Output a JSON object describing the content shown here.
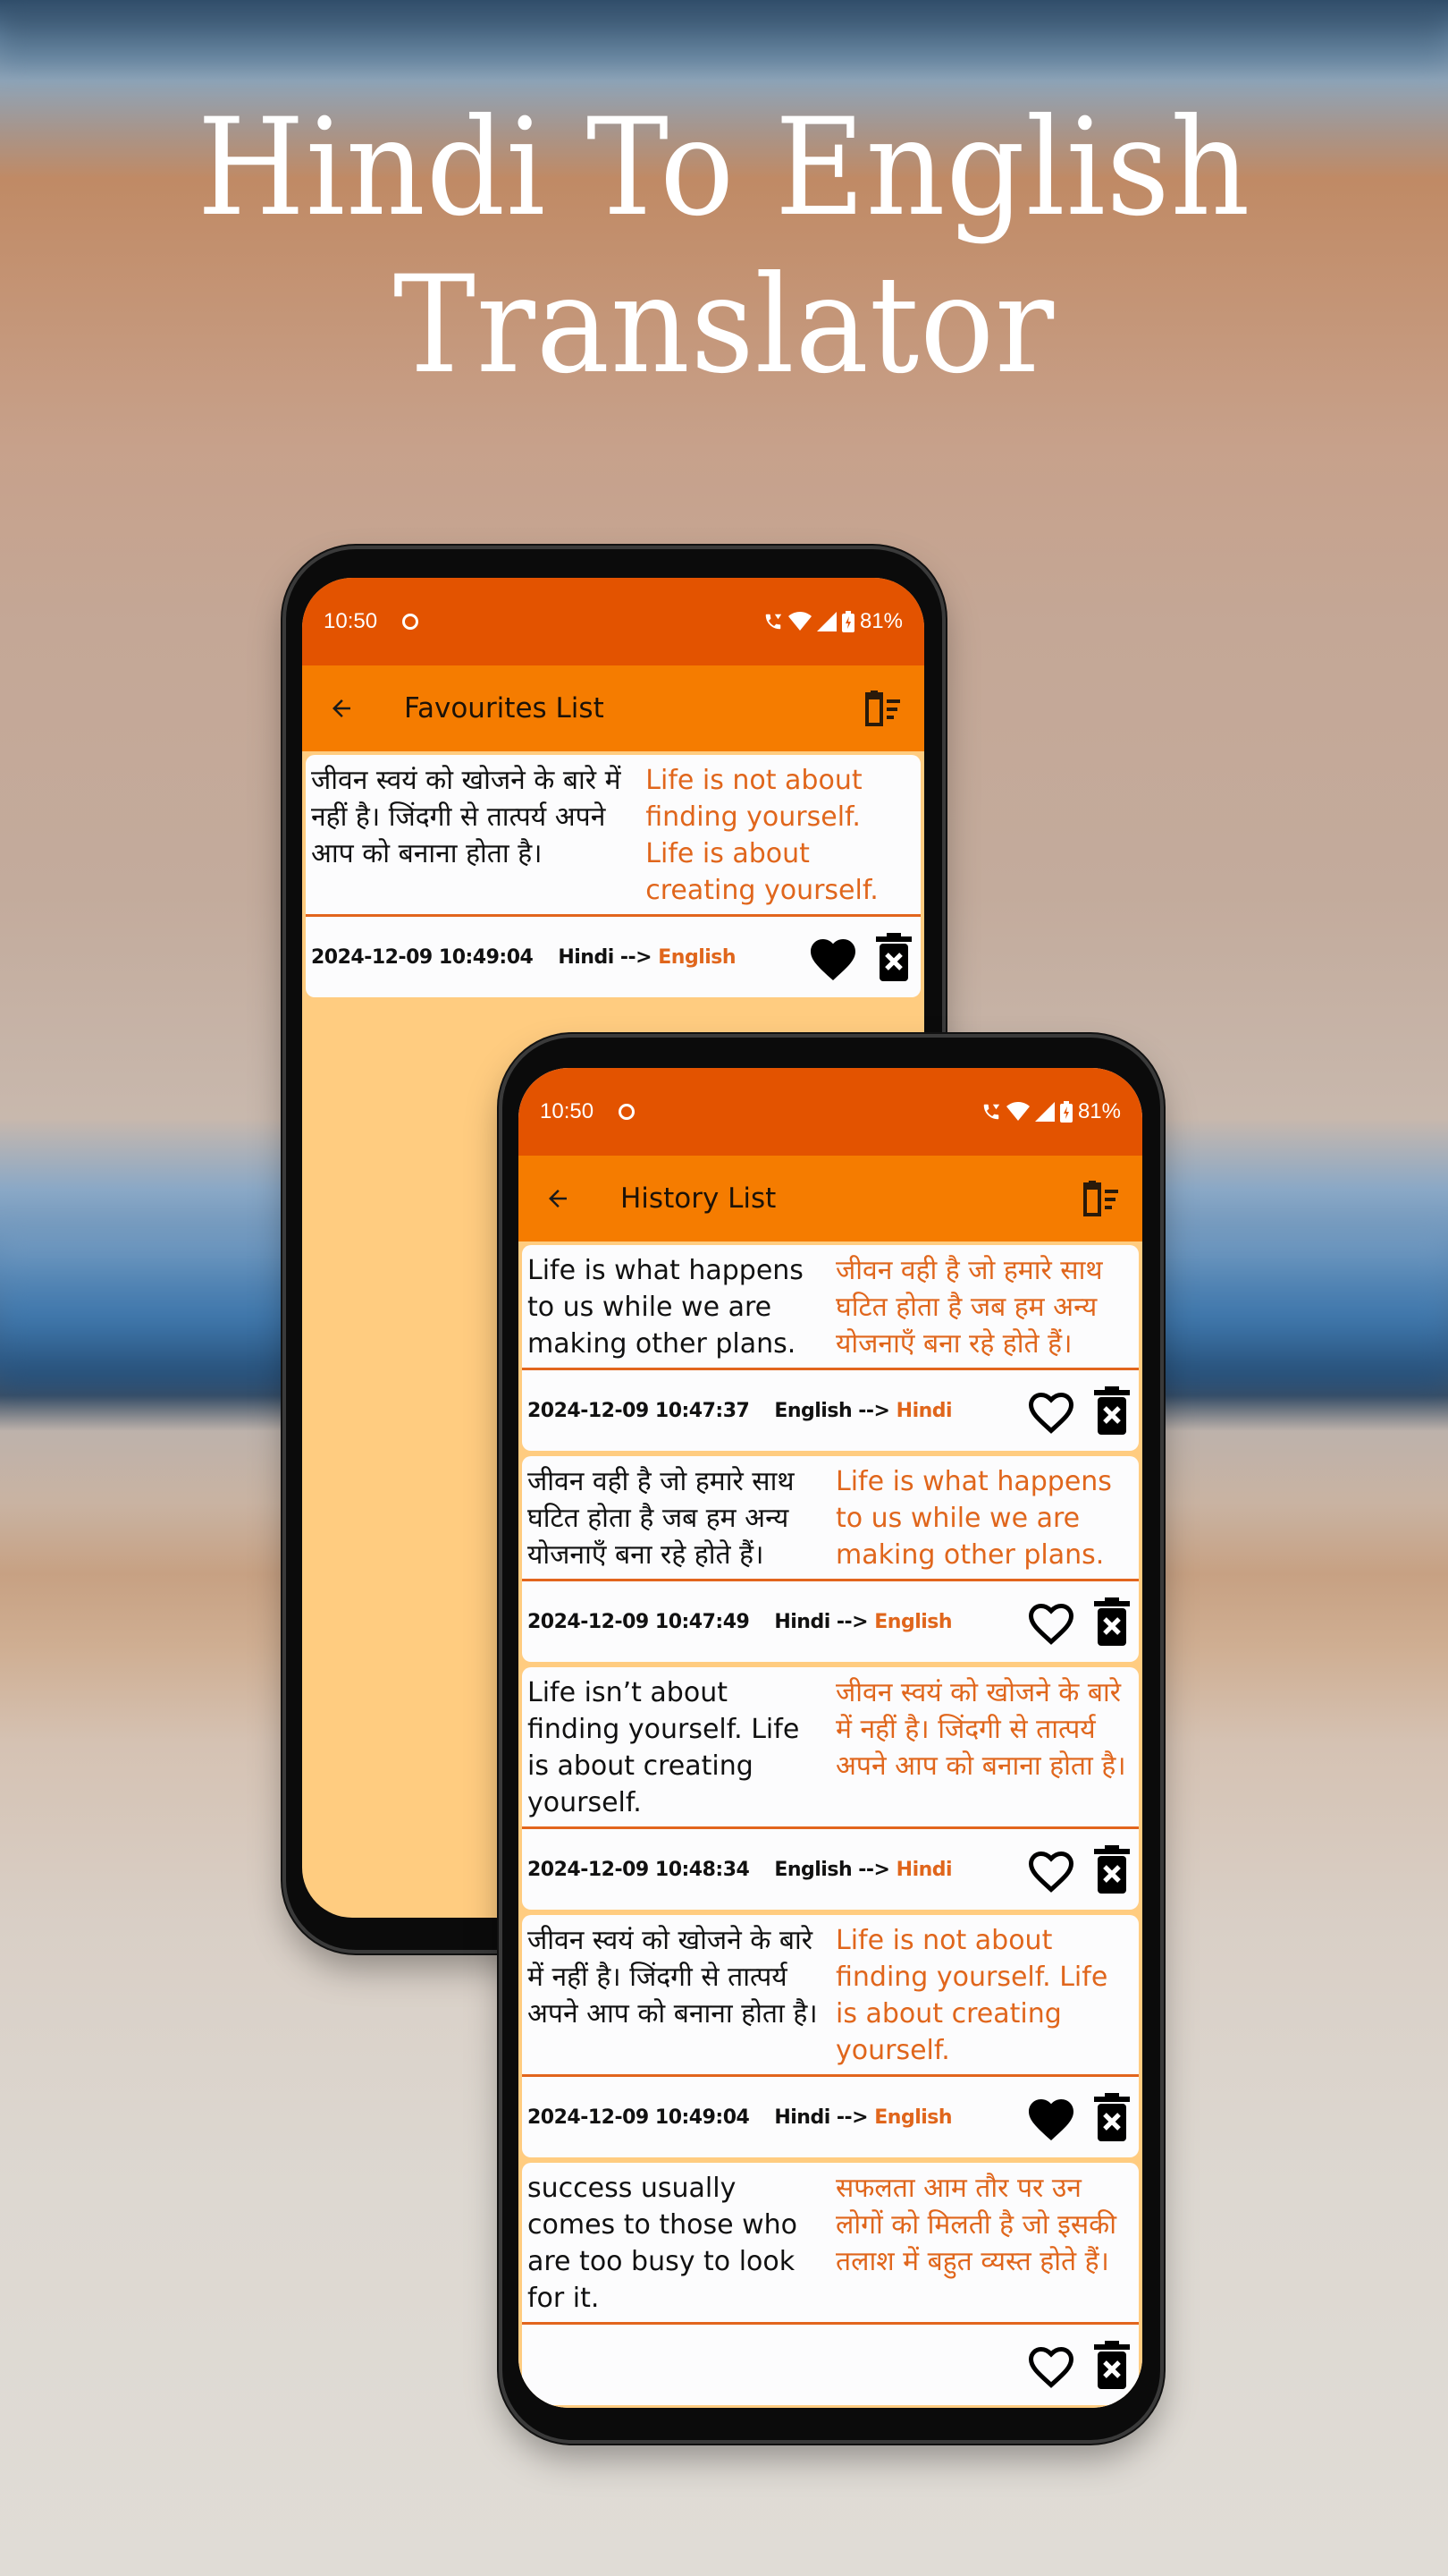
{
  "headline": {
    "line1": "Hindi To English",
    "line2": "Translator"
  },
  "colors": {
    "status_bar": "#e35300",
    "app_bar": "#f57c00",
    "list_background": "#ffcc80",
    "accent_text": "#e0661c"
  },
  "favourites_screen": {
    "status": {
      "time": "10:50",
      "battery": "81%"
    },
    "app_bar": {
      "title": "Favourites List",
      "back_icon": "arrow-left-icon",
      "clear_icon": "delete-sweep-icon"
    },
    "items": [
      {
        "source": "जीवन स्वयं को खोजने के बारे में नहीं है। जिंदगी से तात्पर्य अपने आप को बनाना होता है।",
        "target": "Life is not about finding yourself. Life is about creating yourself.",
        "timestamp": "2024-12-09 10:49:04",
        "from_lang": "Hindi",
        "arrow": "-->",
        "to_lang": "English",
        "favourite": true
      }
    ]
  },
  "history_screen": {
    "status": {
      "time": "10:50",
      "battery": "81%"
    },
    "app_bar": {
      "title": "History List",
      "back_icon": "arrow-left-icon",
      "clear_icon": "delete-sweep-icon"
    },
    "items": [
      {
        "source": "Life is what happens to us while we are making other plans.",
        "target": "जीवन वही है जो हमारे साथ घटित होता है जब हम अन्य योजनाएँ बना रहे होते हैं।",
        "timestamp": "2024-12-09 10:47:37",
        "from_lang": "English",
        "arrow": "-->",
        "to_lang": "Hindi",
        "favourite": false
      },
      {
        "source": "जीवन वही है जो हमारे साथ घटित होता है जब हम अन्य योजनाएँ बना रहे होते हैं।",
        "target": "Life is what happens to us while we are making other plans.",
        "timestamp": "2024-12-09 10:47:49",
        "from_lang": "Hindi",
        "arrow": "-->",
        "to_lang": "English",
        "favourite": false
      },
      {
        "source": "Life isn’t about finding yourself. Life is about creating yourself.",
        "target": "जीवन स्वयं को खोजने के बारे में नहीं है। जिंदगी से तात्पर्य अपने आप को बनाना होता है।",
        "timestamp": "2024-12-09 10:48:34",
        "from_lang": "English",
        "arrow": "-->",
        "to_lang": "Hindi",
        "favourite": false
      },
      {
        "source": "जीवन स्वयं को खोजने के बारे में नहीं है। जिंदगी से तात्पर्य अपने आप को बनाना होता है।",
        "target": "Life is not about finding yourself. Life is about creating yourself.",
        "timestamp": "2024-12-09 10:49:04",
        "from_lang": "Hindi",
        "arrow": "-->",
        "to_lang": "English",
        "favourite": true
      },
      {
        "source": "success usually comes to those who are too busy to look for it.",
        "target": "सफलता आम तौर पर उन लोगों को मिलती है जो इसकी तलाश में बहुत व्यस्त होते हैं।",
        "timestamp": "",
        "from_lang": "",
        "arrow": "",
        "to_lang": "",
        "favourite": false
      }
    ]
  }
}
